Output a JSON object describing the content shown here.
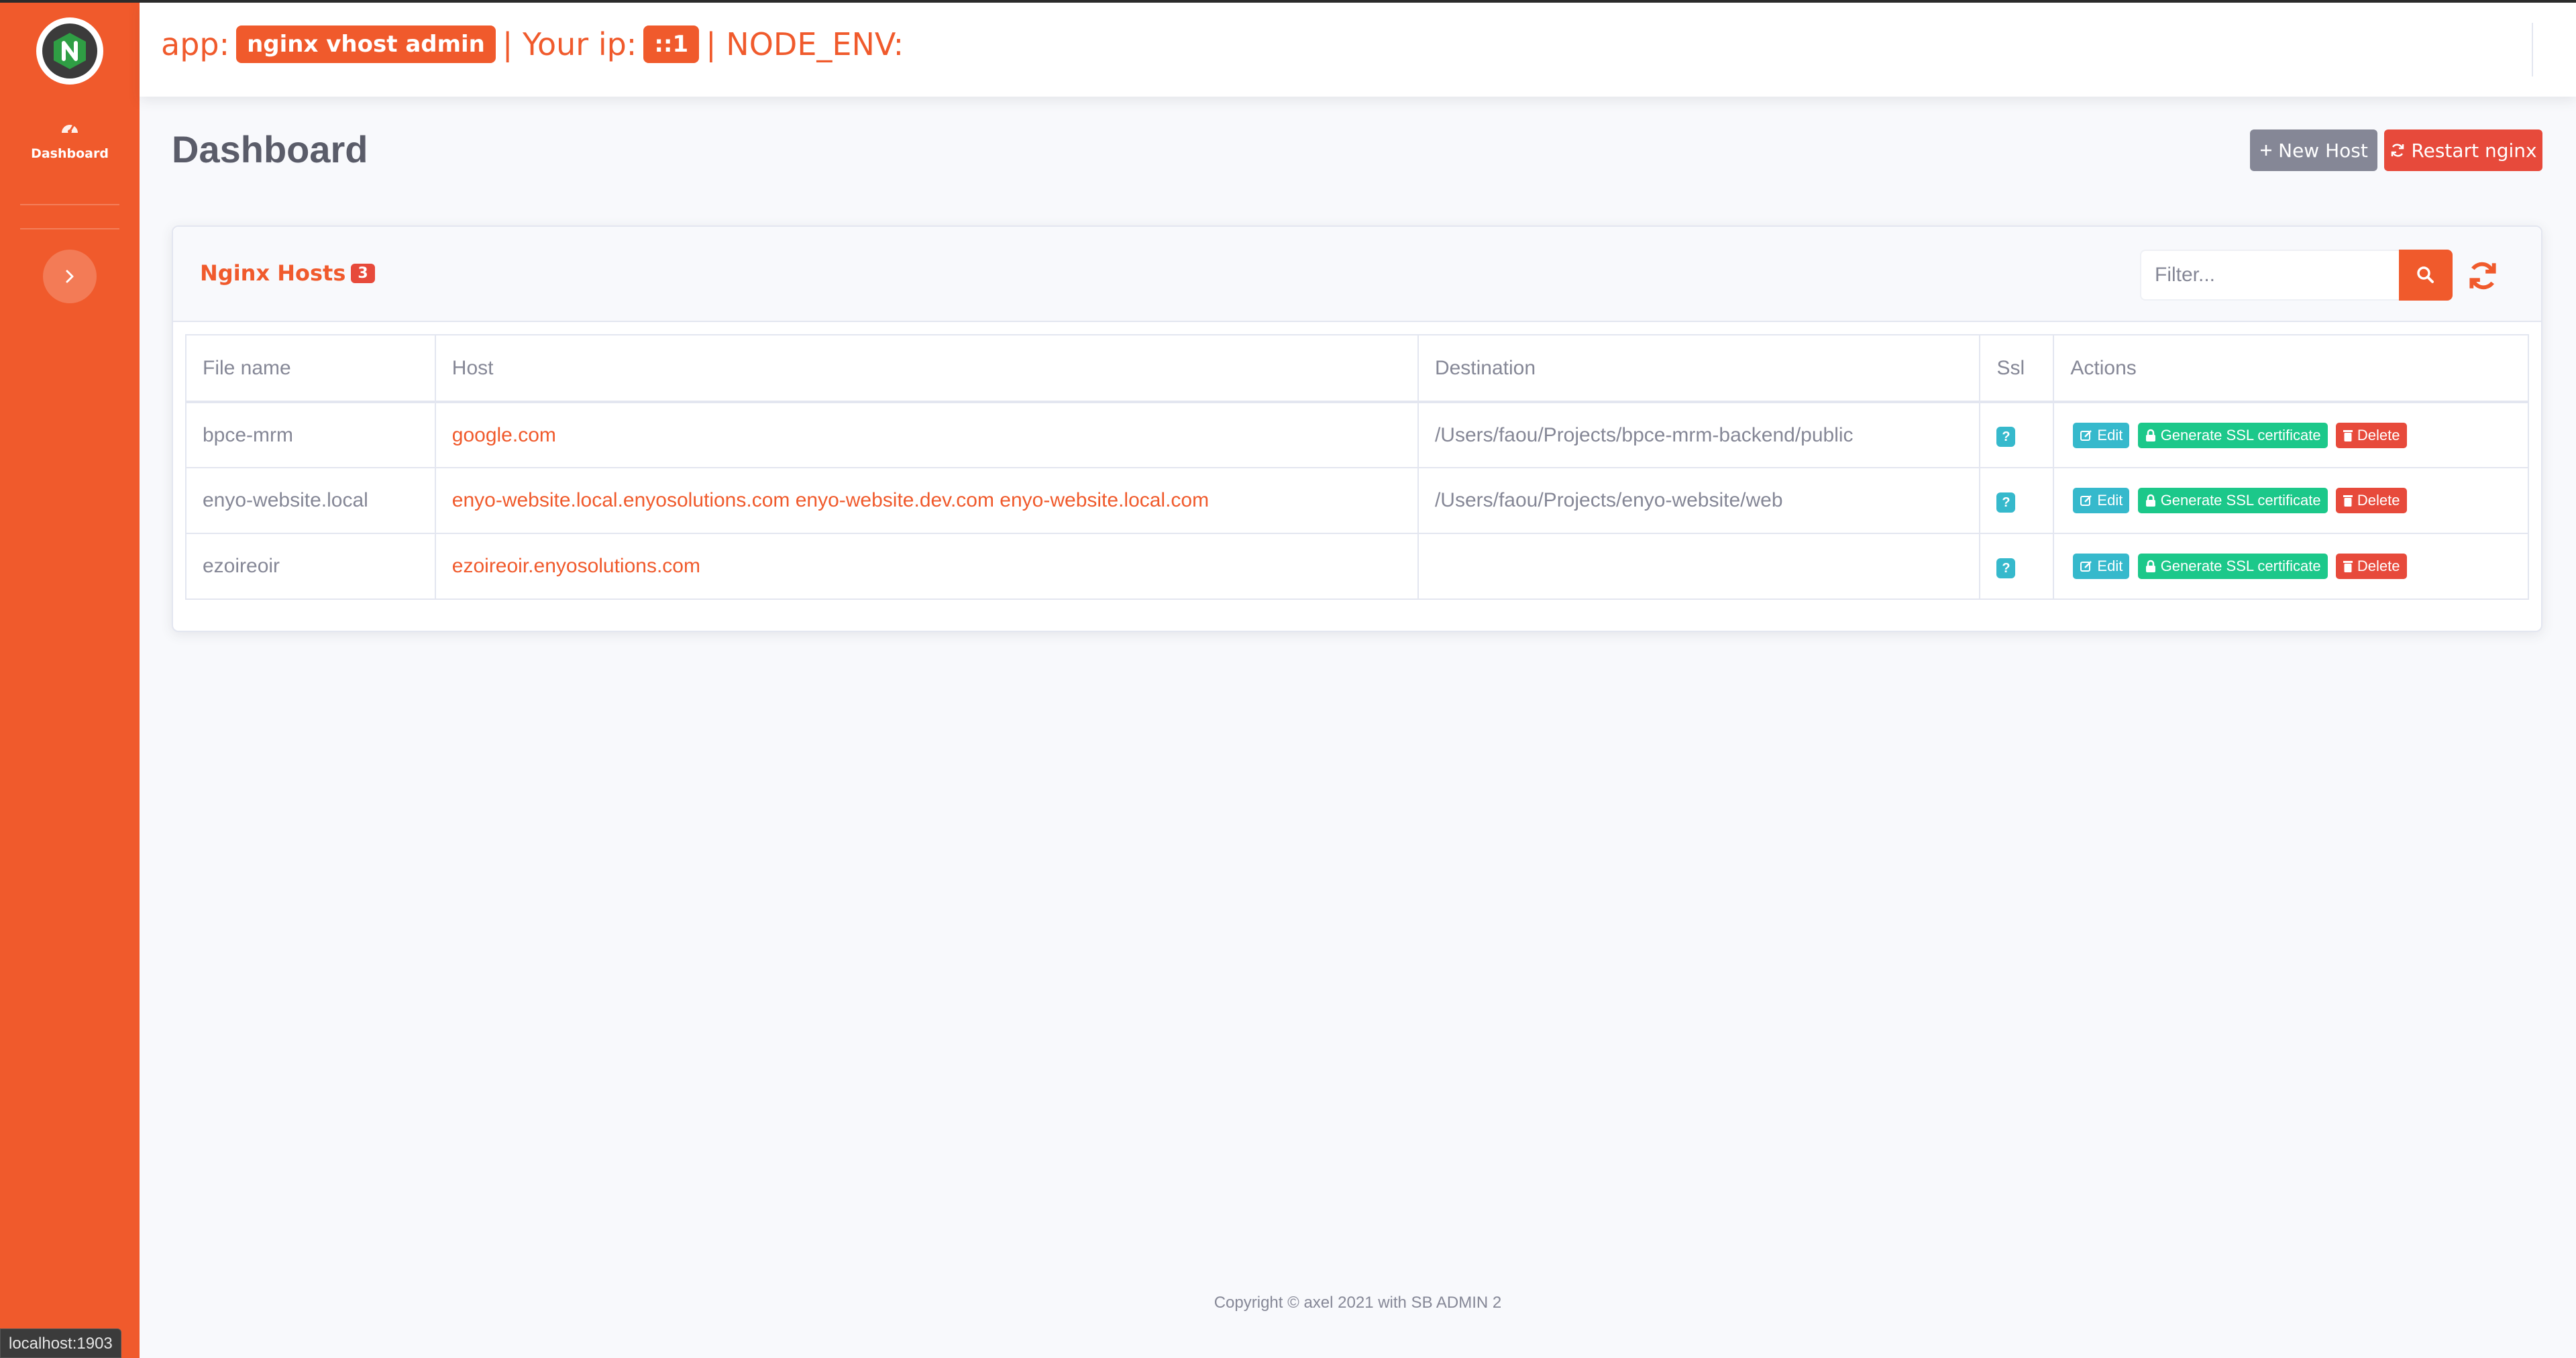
{
  "sidebar": {
    "brand_logo_letter": "N",
    "nav_dashboard_label": "Dashboard",
    "icons": {
      "dashboard": "tachometer-icon",
      "toggle": "chevron-right-icon"
    }
  },
  "topbar": {
    "app_prefix": "app:",
    "app_name": "nginx vhost admin",
    "ip_prefix": "| Your ip:",
    "ip_value": "::1",
    "env_label": "| NODE_ENV:"
  },
  "header": {
    "title": "Dashboard",
    "new_host_label": "New Host",
    "restart_label": "Restart nginx"
  },
  "card": {
    "title": "Nginx Hosts",
    "count": "3",
    "filter_placeholder": "Filter..."
  },
  "table": {
    "columns": [
      "File name",
      "Host",
      "Destination",
      "Ssl",
      "Actions"
    ],
    "rows": [
      {
        "file": "bpce-mrm",
        "host": "google.com",
        "destination": "/Users/faou/Projects/bpce-mrm-backend/public",
        "ssl": "?"
      },
      {
        "file": "enyo-website.local",
        "host": "enyo-website.local.enyosolutions.com enyo-website.dev.com enyo-website.local.com",
        "destination": "/Users/faou/Projects/enyo-website/web",
        "ssl": "?"
      },
      {
        "file": "ezoireoir",
        "host": "ezoireoir.enyosolutions.com",
        "destination": "",
        "ssl": "?"
      }
    ],
    "actions": {
      "edit": "Edit",
      "ssl": "Generate SSL certificate",
      "delete": "Delete"
    }
  },
  "footer": {
    "text": "Copyright © axel 2021 with SB ADMIN 2"
  },
  "status_bar": {
    "url": "localhost:1903"
  },
  "colors": {
    "primary": "#f05a2c",
    "secondary": "#858796",
    "danger": "#e74a3b",
    "info": "#36b9cc",
    "success": "#1cc88a"
  }
}
